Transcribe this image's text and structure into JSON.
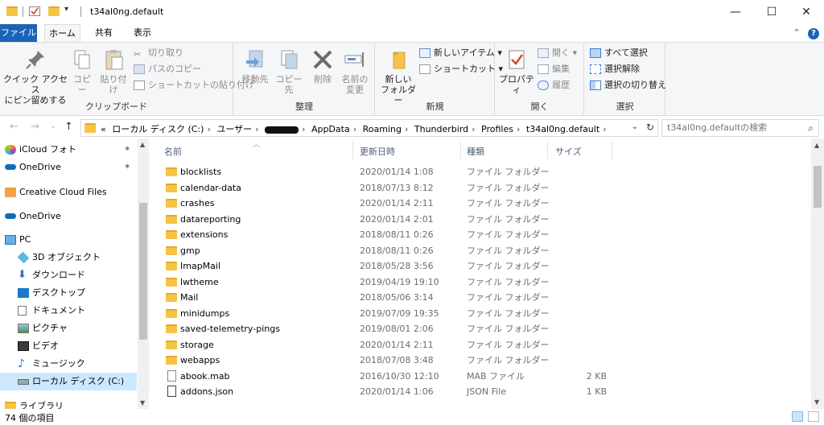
{
  "window": {
    "title": "t34al0ng.default",
    "minimize_glyph": "—",
    "maximize_glyph": "☐",
    "close_glyph": "✕",
    "quick_access_dropdown": "▾"
  },
  "tabs": {
    "file": "ファイル",
    "home": "ホーム",
    "share": "共有",
    "view": "表示",
    "collapse_glyph": "⌃",
    "help_glyph": "?"
  },
  "ribbon": {
    "clipboard": {
      "label": "クリップボード",
      "pin_line1": "クイック アクセス",
      "pin_line2": "にピン留めする",
      "copy": "コピー",
      "paste": "貼り付け",
      "cut": "切り取り",
      "copy_path": "パスのコピー",
      "paste_shortcut": "ショートカットの貼り付け"
    },
    "organize": {
      "label": "整理",
      "move_to": "移動先",
      "copy_to": "コピー先",
      "delete": "削除",
      "rename_line1": "名前の",
      "rename_line2": "変更"
    },
    "new": {
      "label": "新規",
      "new_folder_line1": "新しい",
      "new_folder_line2": "フォルダー",
      "new_item": "新しいアイテム ▾",
      "shortcut": "ショートカット ▾"
    },
    "open": {
      "label": "開く",
      "properties": "プロパティ",
      "open": "開く ▾",
      "edit": "編集",
      "history": "履歴"
    },
    "select": {
      "label": "選択",
      "select_all": "すべて選択",
      "select_none": "選択解除",
      "invert": "選択の切り替え"
    }
  },
  "address": {
    "back": "←",
    "forward": "→",
    "recent": "⌄",
    "up": "↑",
    "overflow": "«",
    "crumbs": [
      "ローカル ディスク (C:)",
      "ユーザー",
      "AppData",
      "Roaming",
      "Thunderbird",
      "Profiles",
      "t34al0ng.default"
    ],
    "sep": "›",
    "dropdown": "⌄",
    "refresh": "↻"
  },
  "search": {
    "placeholder": "t34al0ng.defaultの検索",
    "icon_glyph": "⌕"
  },
  "nav": {
    "items": [
      {
        "label": "iCloud フォト",
        "icon": "icloud-photos-icon",
        "pinned": true
      },
      {
        "label": "OneDrive",
        "icon": "onedrive-icon",
        "pinned": true
      },
      {
        "label": "Creative Cloud Files",
        "icon": "creative-cloud-icon",
        "pinned": false
      },
      {
        "label": "OneDrive",
        "icon": "onedrive-icon",
        "pinned": false
      },
      {
        "label": "PC",
        "icon": "pc-icon",
        "pinned": false
      },
      {
        "label": "3D オブジェクト",
        "icon": "3d-objects-icon",
        "pinned": false
      },
      {
        "label": "ダウンロード",
        "icon": "downloads-icon",
        "pinned": false
      },
      {
        "label": "デスクトップ",
        "icon": "desktop-icon",
        "pinned": false
      },
      {
        "label": "ドキュメント",
        "icon": "documents-icon",
        "pinned": false
      },
      {
        "label": "ピクチャ",
        "icon": "pictures-icon",
        "pinned": false
      },
      {
        "label": "ビデオ",
        "icon": "videos-icon",
        "pinned": false
      },
      {
        "label": "ミュージック",
        "icon": "music-icon",
        "pinned": false
      },
      {
        "label": "ローカル ディスク (C:)",
        "icon": "local-disk-icon",
        "pinned": false,
        "selected": true
      },
      {
        "label": "ライブラリ",
        "icon": "libraries-icon",
        "pinned": false
      }
    ],
    "pin_glyph": "📌"
  },
  "columns": {
    "name": "名前",
    "modified": "更新日時",
    "type": "種類",
    "size": "サイズ"
  },
  "files": [
    {
      "name": "blocklists",
      "date": "2020/01/14 1:08",
      "type": "ファイル フォルダー",
      "size": "",
      "kind": "folder"
    },
    {
      "name": "calendar-data",
      "date": "2018/07/13 8:12",
      "type": "ファイル フォルダー",
      "size": "",
      "kind": "folder"
    },
    {
      "name": "crashes",
      "date": "2020/01/14 2:11",
      "type": "ファイル フォルダー",
      "size": "",
      "kind": "folder"
    },
    {
      "name": "datareporting",
      "date": "2020/01/14 2:01",
      "type": "ファイル フォルダー",
      "size": "",
      "kind": "folder"
    },
    {
      "name": "extensions",
      "date": "2018/08/11 0:26",
      "type": "ファイル フォルダー",
      "size": "",
      "kind": "folder"
    },
    {
      "name": "gmp",
      "date": "2018/08/11 0:26",
      "type": "ファイル フォルダー",
      "size": "",
      "kind": "folder"
    },
    {
      "name": "ImapMail",
      "date": "2018/05/28 3:56",
      "type": "ファイル フォルダー",
      "size": "",
      "kind": "folder"
    },
    {
      "name": "lwtheme",
      "date": "2019/04/19 19:10",
      "type": "ファイル フォルダー",
      "size": "",
      "kind": "folder"
    },
    {
      "name": "Mail",
      "date": "2018/05/06 3:14",
      "type": "ファイル フォルダー",
      "size": "",
      "kind": "folder"
    },
    {
      "name": "minidumps",
      "date": "2019/07/09 19:35",
      "type": "ファイル フォルダー",
      "size": "",
      "kind": "folder"
    },
    {
      "name": "saved-telemetry-pings",
      "date": "2019/08/01 2:06",
      "type": "ファイル フォルダー",
      "size": "",
      "kind": "folder"
    },
    {
      "name": "storage",
      "date": "2020/01/14 2:11",
      "type": "ファイル フォルダー",
      "size": "",
      "kind": "folder"
    },
    {
      "name": "webapps",
      "date": "2018/07/08 3:48",
      "type": "ファイル フォルダー",
      "size": "",
      "kind": "folder"
    },
    {
      "name": "abook.mab",
      "date": "2016/10/30 12:10",
      "type": "MAB ファイル",
      "size": "2 KB",
      "kind": "file"
    },
    {
      "name": "addons.json",
      "date": "2020/01/14 1:06",
      "type": "JSON File",
      "size": "1 KB",
      "kind": "json"
    }
  ],
  "status": {
    "count": "74 個の項目"
  }
}
